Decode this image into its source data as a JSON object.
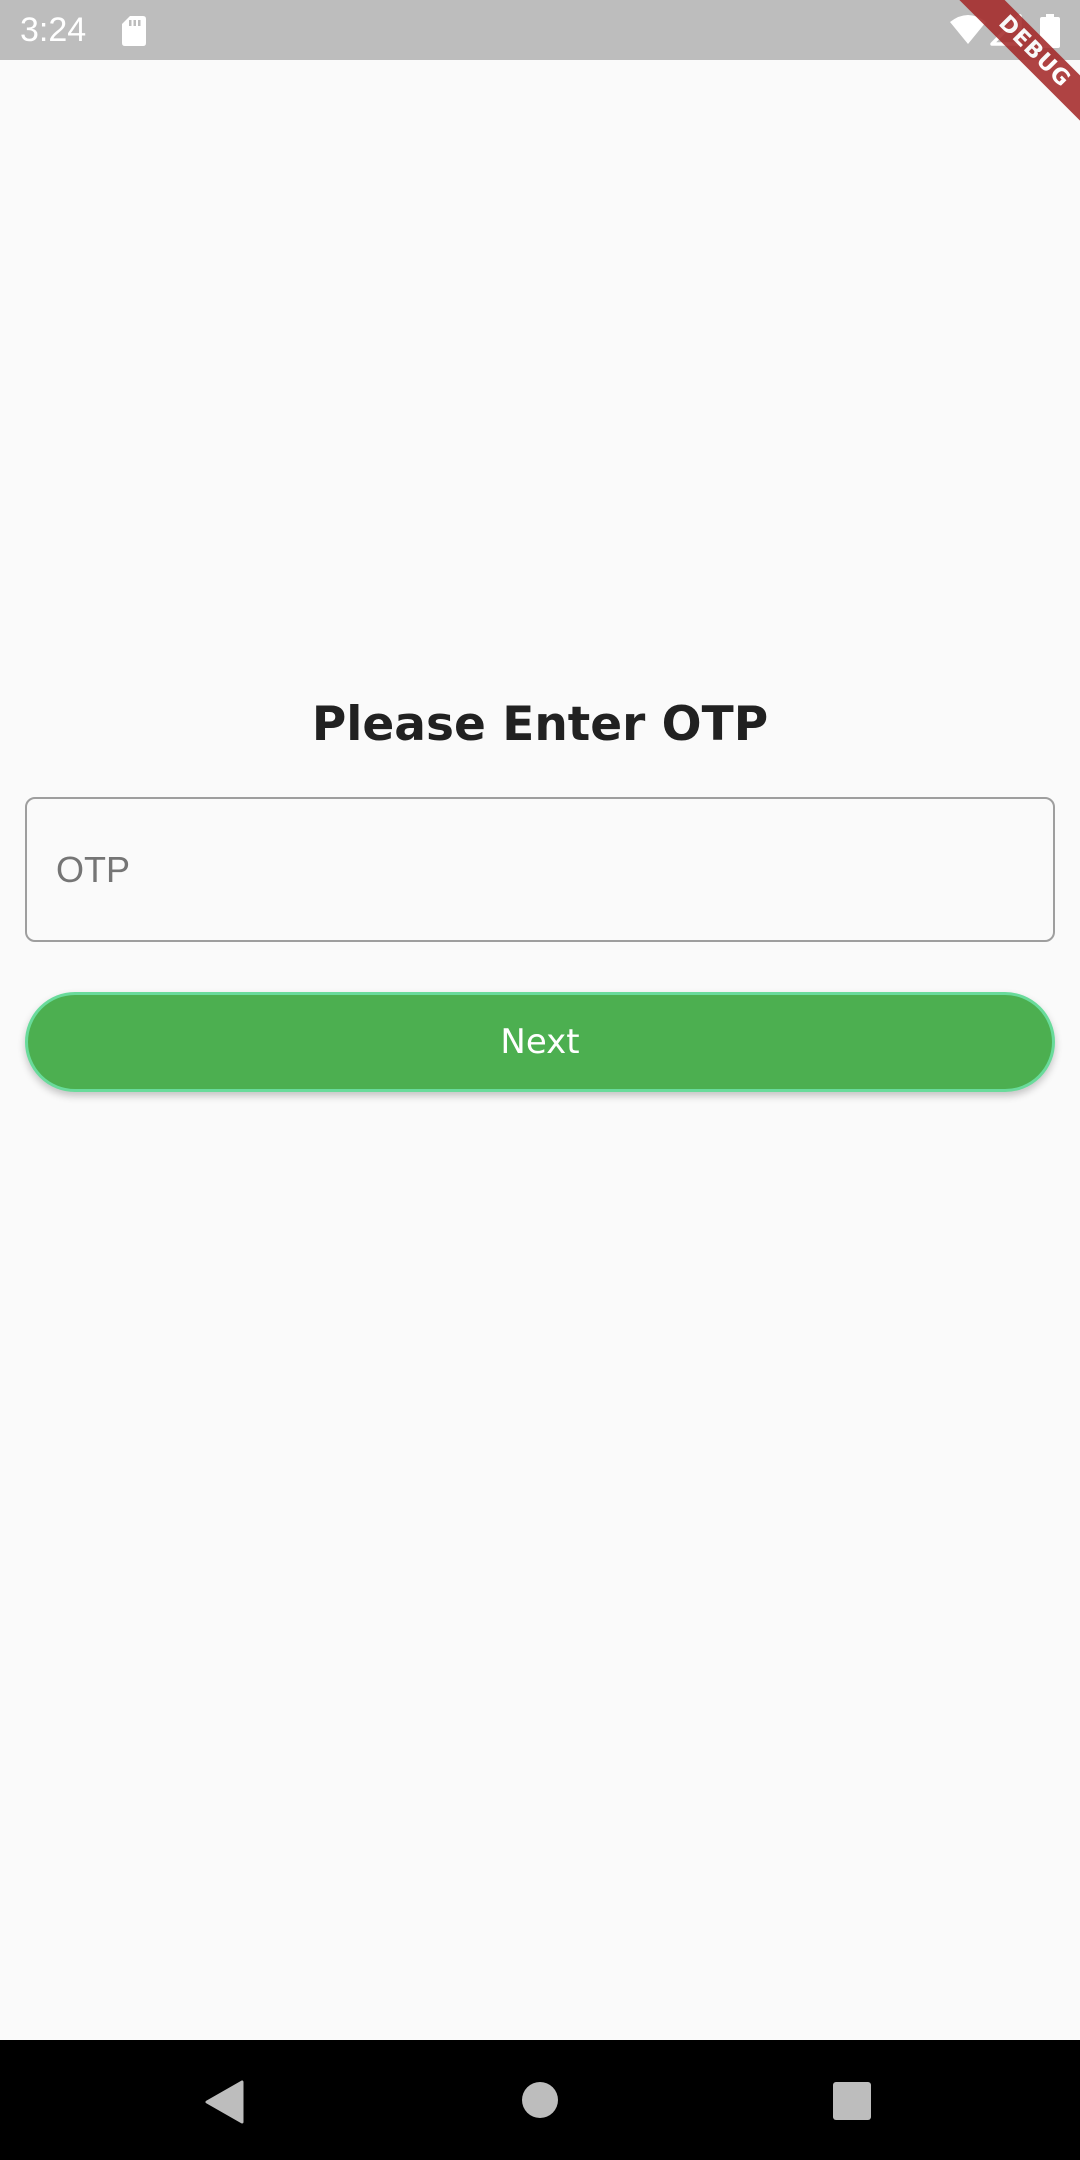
{
  "status_bar": {
    "time": "3:24",
    "icons": [
      "sd-card-icon",
      "wifi-icon",
      "signal-icon",
      "battery-icon"
    ]
  },
  "debug_banner": {
    "label": "DEBUG",
    "color": "#a52a2a"
  },
  "main": {
    "title": "Please Enter OTP",
    "otp_field": {
      "placeholder": "OTP",
      "value": ""
    },
    "next_button": {
      "label": "Next",
      "color": "#4caf50"
    }
  },
  "nav_bar": {
    "icons": [
      "back-icon",
      "home-icon",
      "recents-icon"
    ]
  }
}
